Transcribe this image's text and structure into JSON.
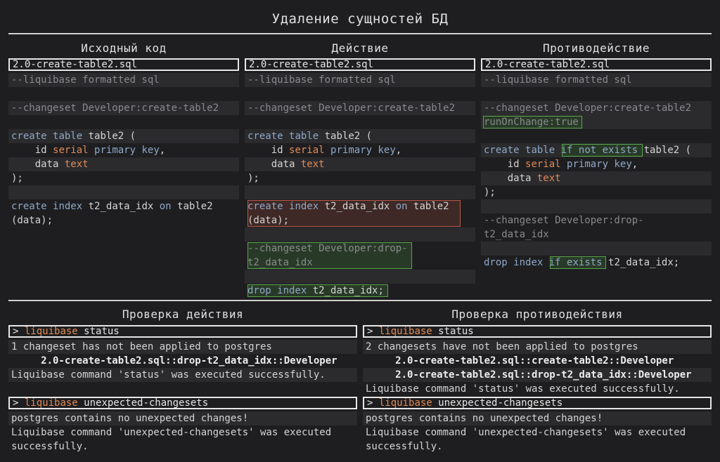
{
  "title": "Удаление сущностей БД",
  "columns": {
    "source": {
      "header": "Исходный код",
      "file": "2.0-create-table2.sql",
      "lines": {
        "formatted": "--liquibase formatted sql",
        "changeset": "--changeset Developer:create-table2",
        "create_kw": "create",
        "table_kw": "table",
        "table_rest": " table2 (",
        "id_name": "    id ",
        "serial": "serial",
        "primary_key": "primary key",
        "comma": ",",
        "data_name": "    data ",
        "text_type": "text",
        "close": ");",
        "idx_create": "create",
        "idx_index": "index",
        "idx_name": " t2_data_idx ",
        "idx_on": "on",
        "idx_table": " table2",
        "idx_cols": "(data);"
      }
    },
    "action": {
      "header": "Действие",
      "file": "2.0-create-table2.sql",
      "lines": {
        "formatted": "--liquibase formatted sql",
        "changeset": "--changeset Developer:create-table2",
        "create_kw": "create",
        "table_kw": "table",
        "table_rest": " table2 (",
        "id_name": "    id ",
        "serial": "serial",
        "primary_key": "primary key",
        "comma": ",",
        "data_name": "    data ",
        "text_type": "text",
        "close": ");",
        "idx_create": "create",
        "idx_index": "index",
        "idx_name": " t2_data_idx ",
        "idx_on": "on",
        "idx_table": " table2",
        "idx_cols": "(data);",
        "drop_changeset_1": "--changeset Developer:drop-",
        "drop_changeset_2": "t2_data_idx",
        "drop_kw": "drop",
        "drop_index": "index",
        "drop_rest": " t2_data_idx;"
      }
    },
    "counter": {
      "header": "Противодействие",
      "file": "2.0-create-table2.sql",
      "lines": {
        "formatted": "--liquibase formatted sql",
        "changeset": "--changeset Developer:create-table2",
        "run_on_change": "runOnChange:true",
        "create_kw": "create",
        "table_kw": "table",
        "if_not_exists": "if not exists",
        "table_rest": " table2 (",
        "id_name": "    id ",
        "serial": "serial",
        "primary_key": "primary key",
        "comma": ",",
        "data_name": "    data ",
        "text_type": "text",
        "close": ");",
        "drop_changeset_1": "--changeset Developer:drop-",
        "drop_changeset_2": "t2_data_idx",
        "drop_kw": "drop",
        "drop_index": "index",
        "if_exists": "if exists",
        "drop_rest": " t2_data_idx;"
      }
    }
  },
  "checks": {
    "action": {
      "header": "Проверка действия",
      "prompt": ">",
      "cmd_name": "liquibase",
      "status_cmd": " status",
      "status_out_1": "1 changeset has not been applied to postgres",
      "status_out_2": "     2.0-create-table2.sql::drop-t2_data_idx::Developer",
      "status_out_3": "Liquibase command 'status' was executed successfully.",
      "unexpected_cmd": " unexpected-changesets",
      "unexpected_out_1": "postgres contains no unexpected changes!",
      "unexpected_out_2": "Liquibase command 'unexpected-changesets' was executed",
      "unexpected_out_3": "successfully."
    },
    "counter": {
      "header": "Проверка противодействия",
      "prompt": ">",
      "cmd_name": "liquibase",
      "status_cmd": " status",
      "status_out_1": "2 changesets have not been applied to postgres",
      "status_out_2": "     2.0-create-table2.sql::create-table2::Developer",
      "status_out_3": "     2.0-create-table2.sql::drop-t2_data_idx::Developer",
      "status_out_4": "Liquibase command 'status' was executed successfully.",
      "unexpected_cmd": " unexpected-changesets",
      "unexpected_out_1": "postgres contains no unexpected changes!",
      "unexpected_out_2": "Liquibase command 'unexpected-changesets' was executed",
      "unexpected_out_3": "successfully."
    }
  },
  "colors": {
    "background": "#1e1e20",
    "band": "#2b2b2e",
    "comment": "#8a8a8e",
    "keyword": "#8fa8c8",
    "type": "#e08a55",
    "removed_border": "#b85a48",
    "added_border": "#5aa54a"
  }
}
